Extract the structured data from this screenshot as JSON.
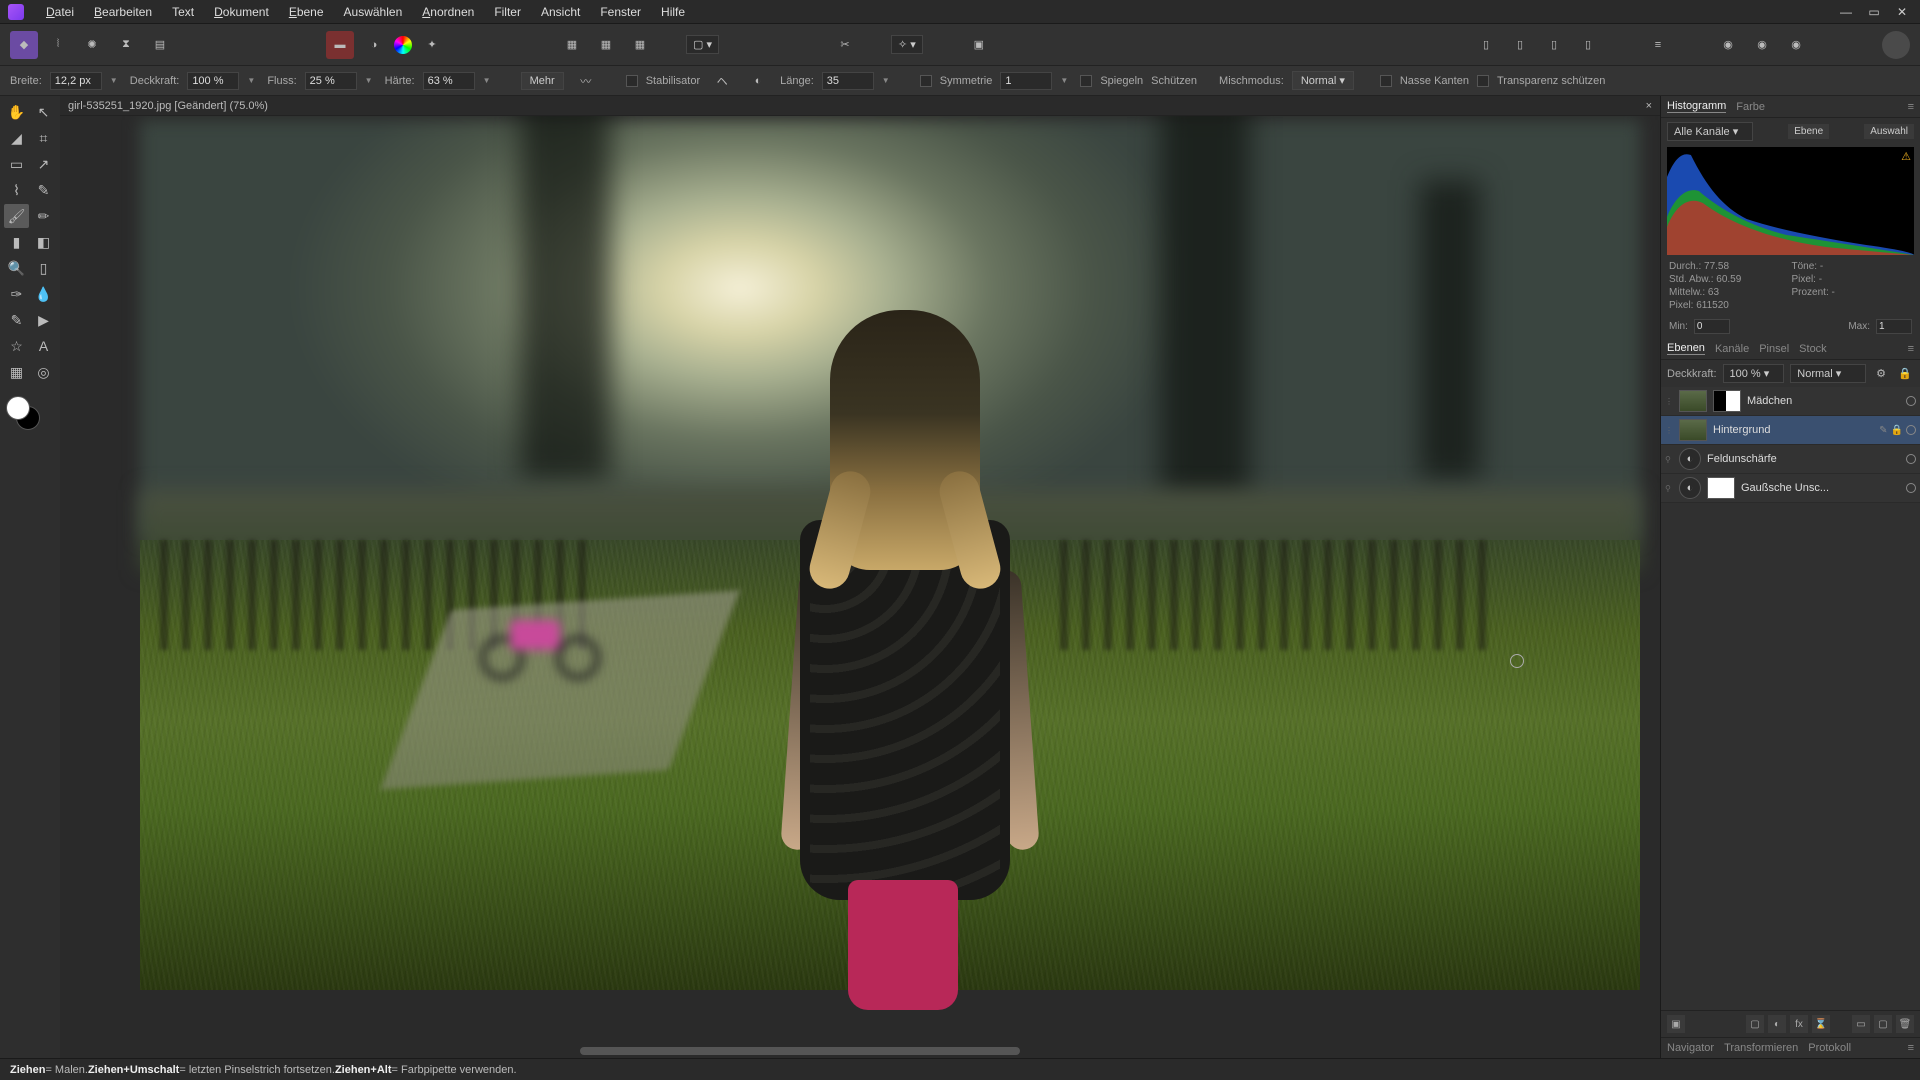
{
  "menu": [
    "Datei",
    "Bearbeiten",
    "Text",
    "Dokument",
    "Ebene",
    "Auswählen",
    "Anordnen",
    "Filter",
    "Ansicht",
    "Fenster",
    "Hilfe"
  ],
  "menu_underline": [
    0,
    0,
    0,
    0,
    0,
    0,
    0,
    0,
    0,
    0,
    0
  ],
  "document": {
    "tab": "girl-535251_1920.jpg [Geändert] (75.0%)"
  },
  "context": {
    "breite_label": "Breite:",
    "breite": "12,2 px",
    "deckkraft_label": "Deckkraft:",
    "deckkraft": "100 %",
    "fluss_label": "Fluss:",
    "fluss": "25 %",
    "haerte_label": "Härte:",
    "haerte": "63 %",
    "mehr": "Mehr",
    "stabilisator": "Stabilisator",
    "laenge_label": "Länge:",
    "laenge": "35",
    "symmetrie": "Symmetrie",
    "symmetrie_val": "1",
    "spiegeln": "Spiegeln",
    "schuetzen": "Schützen",
    "mischmodus_label": "Mischmodus:",
    "mischmodus": "Normal",
    "nasse": "Nasse Kanten",
    "transparenz": "Transparenz schützen"
  },
  "histogram": {
    "tab1": "Histogramm",
    "tab2": "Farbe",
    "channels": "Alle Kanäle",
    "btn_ebene": "Ebene",
    "btn_auswahl": "Auswahl",
    "stats": {
      "durch": "Durch.: 77.58",
      "toene": "Töne: -",
      "std": "Std. Abw.: 60.59",
      "pixel_r": "Pixel: -",
      "mittelw": "Mittelw.: 63",
      "prozent": "Prozent: -",
      "pixel": "Pixel: 611520"
    },
    "min_label": "Min:",
    "min": "0",
    "max_label": "Max:",
    "max": "1"
  },
  "layers": {
    "tab_ebenen": "Ebenen",
    "tab_kanaele": "Kanäle",
    "tab_pinsel": "Pinsel",
    "tab_stock": "Stock",
    "deckkraft_label": "Deckkraft:",
    "deckkraft": "100 %",
    "blend": "Normal",
    "items": [
      {
        "name": "Mädchen"
      },
      {
        "name": "Hintergrund"
      },
      {
        "name": "Feldunschärfe"
      },
      {
        "name": "Gaußsche Unsc..."
      }
    ]
  },
  "bottom_tabs": {
    "nav": "Navigator",
    "trans": "Transformieren",
    "prot": "Protokoll"
  },
  "statusbar": {
    "a": "Ziehen",
    "a2": " = Malen. ",
    "b": "Ziehen+Umschalt",
    "b2": " = letzten Pinselstrich fortsetzen. ",
    "c": "Ziehen+Alt",
    "c2": " = Farbpipette verwenden."
  }
}
